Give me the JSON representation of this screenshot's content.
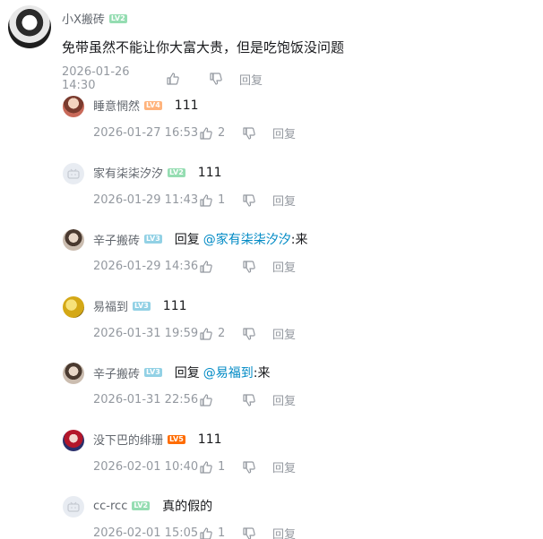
{
  "top_comment": {
    "username": "小X搬砖",
    "level": "LV2",
    "level_color": "#95ddb2",
    "content": "免带虽然不能让你大富大贵，但是吃饱饭没问题",
    "time": "2026-01-26 14:30",
    "reply_label": "回复"
  },
  "replies": [
    {
      "username": "睡意惘然",
      "level": "LV4",
      "level_color": "#ffb37c",
      "text": "111",
      "time": "2026-01-27 16:53",
      "likes": "2",
      "reply_label": "回复",
      "avatar": "anime-girl"
    },
    {
      "username": "家有柒柒汐汐",
      "level": "LV2",
      "level_color": "#95ddb2",
      "text": "111",
      "time": "2026-01-29 11:43",
      "likes": "1",
      "reply_label": "回复",
      "avatar": "default-tv"
    },
    {
      "username": "辛子搬砖",
      "level": "LV3",
      "level_color": "#92d1e5",
      "reply_word": "回复",
      "mention": "@家有柒柒汐汐",
      "suffix": ":来",
      "time": "2026-01-29 14:36",
      "likes": "",
      "reply_label": "回复",
      "avatar": "person"
    },
    {
      "username": "易福到",
      "level": "LV3",
      "level_color": "#92d1e5",
      "text": "111",
      "time": "2026-01-31 19:59",
      "likes": "2",
      "reply_label": "回复",
      "avatar": "gold"
    },
    {
      "username": "辛子搬砖",
      "level": "LV3",
      "level_color": "#92d1e5",
      "reply_word": "回复",
      "mention": "@易福到",
      "suffix": ":来",
      "time": "2026-01-31 22:56",
      "likes": "",
      "reply_label": "回复",
      "avatar": "person"
    },
    {
      "username": "没下巴的绯珊",
      "level": "LV5",
      "level_color": "#ff6c00",
      "text": "111",
      "time": "2026-02-01 10:40",
      "likes": "1",
      "reply_label": "回复",
      "avatar": "anime-red"
    },
    {
      "username": "cc-rcc",
      "level": "LV2",
      "level_color": "#95ddb2",
      "text": "真的假的",
      "time": "2026-02-01 15:05",
      "likes": "1",
      "reply_label": "回复",
      "avatar": "default-tv"
    }
  ]
}
